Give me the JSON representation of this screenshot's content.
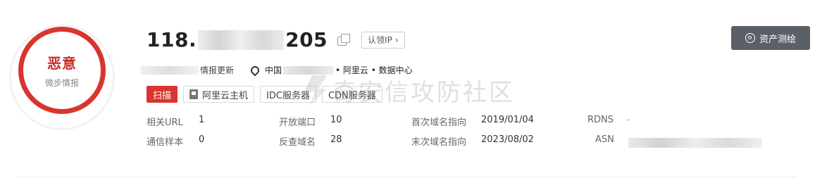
{
  "verdict": {
    "label": "恶意",
    "source": "微步情报"
  },
  "ip": {
    "prefix": "118.",
    "suffix": "205"
  },
  "claim_ip": "认领IP",
  "claim_chevron": "›",
  "report_button": "资产测绘",
  "intel_update": "情报更新",
  "location": {
    "country": "中国",
    "provider": "• 阿里云 • 数据中心"
  },
  "tags": [
    "扫描",
    "阿里云主机",
    "IDC服务器",
    "CDN服务器"
  ],
  "stats": {
    "related_url": {
      "label": "相关URL",
      "value": "1"
    },
    "comm_samples": {
      "label": "通信样本",
      "value": "0"
    },
    "open_ports": {
      "label": "开放端口",
      "value": "10"
    },
    "reverse_domains": {
      "label": "反查域名",
      "value": "28"
    },
    "first_domain": {
      "label": "首次域名指向",
      "value": "2019/01/04"
    },
    "last_domain": {
      "label": "末次域名指向",
      "value": "2023/08/02"
    },
    "rdns": {
      "label": "RDNS",
      "value": "-"
    },
    "asn": {
      "label": "ASN",
      "value": ""
    }
  },
  "watermark": "奇安信攻防社区",
  "colors": {
    "danger": "#d9342f",
    "button_dark": "#5b6067"
  }
}
